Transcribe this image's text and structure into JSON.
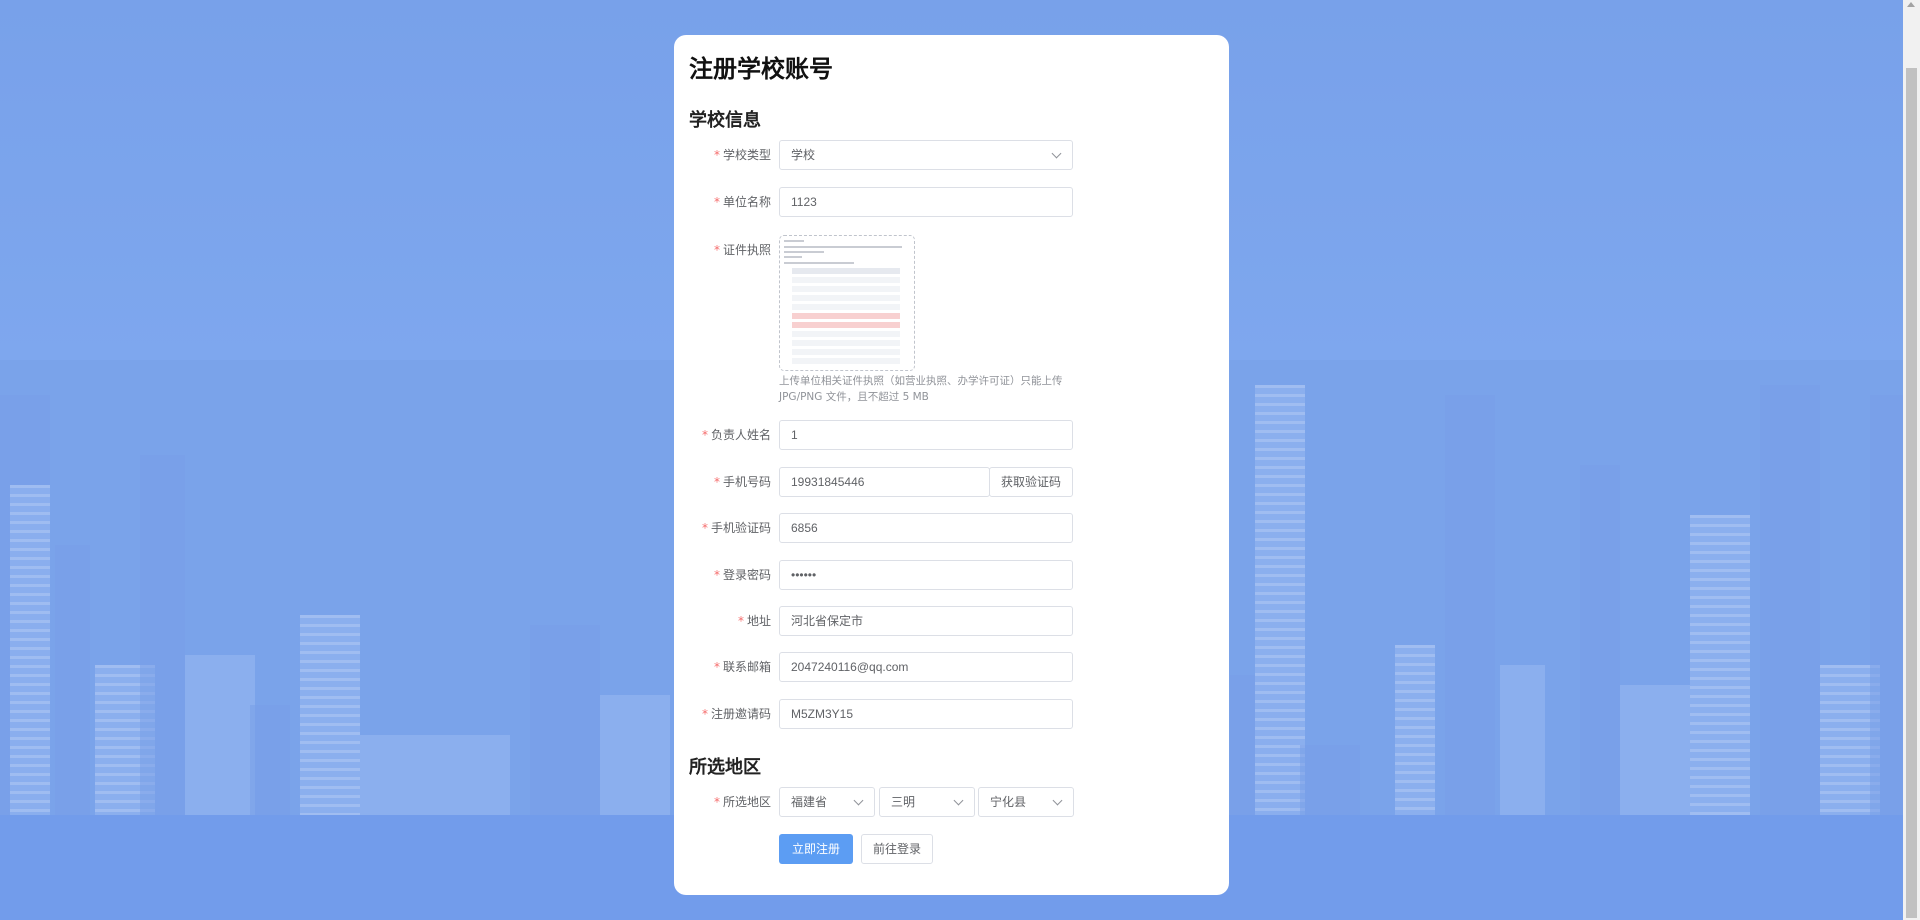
{
  "page": {
    "title": "注册学校账号"
  },
  "school_section": {
    "title": "学校信息",
    "fields": {
      "school_type": {
        "label": "学校类型",
        "value": "学校"
      },
      "unit_name": {
        "label": "单位名称",
        "value": "1123"
      },
      "license": {
        "label": "证件执照",
        "tip": "上传单位相关证件执照（如营业执照、办学许可证）只能上传 JPG/PNG 文件，且不超过 5 MB"
      },
      "principal_name": {
        "label": "负责人姓名",
        "value": "1"
      },
      "phone": {
        "label": "手机号码",
        "value": "19931845446",
        "code_button": "获取验证码"
      },
      "sms_code": {
        "label": "手机验证码",
        "value": "6856"
      },
      "password": {
        "label": "登录密码",
        "value": "••••••"
      },
      "address": {
        "label": "地址",
        "value": "河北省保定市"
      },
      "email": {
        "label": "联系邮箱",
        "value": "2047240116@qq.com"
      },
      "invite_code": {
        "label": "注册邀请码",
        "value": "M5ZM3Y15"
      }
    }
  },
  "region_section": {
    "title": "所选地区",
    "label": "所选地区",
    "province": "福建省",
    "city": "三明",
    "county": "宁化县"
  },
  "actions": {
    "register": "立即注册",
    "login": "前往登录"
  },
  "required_mark": "*",
  "colors": {
    "background": "#7aa3ea",
    "primary": "#5c9df3",
    "required": "#f56c6c"
  }
}
